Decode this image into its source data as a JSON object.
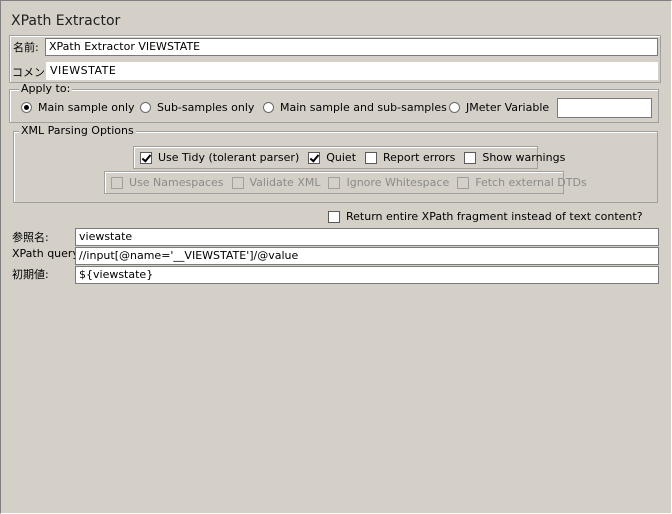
{
  "panel": {
    "title": "XPath Extractor"
  },
  "name_row": {
    "label": "名前:",
    "value": "XPath Extractor VIEWSTATE"
  },
  "comment_row": {
    "label": "コメント",
    "value": "VIEWSTATE"
  },
  "apply_to": {
    "legend": "Apply to:",
    "options": [
      {
        "label": "Main sample only",
        "selected": true
      },
      {
        "label": "Sub-samples only",
        "selected": false
      },
      {
        "label": "Main sample and sub-samples",
        "selected": false
      },
      {
        "label": "JMeter Variable",
        "selected": false
      }
    ],
    "variable_value": ""
  },
  "xml_parsing": {
    "legend": "XML Parsing Options",
    "tidy_options": [
      {
        "label": "Use Tidy (tolerant parser)",
        "checked": true
      },
      {
        "label": "Quiet",
        "checked": true
      },
      {
        "label": "Report errors",
        "checked": false
      },
      {
        "label": "Show warnings",
        "checked": false
      }
    ],
    "namespace_options": [
      {
        "label": "Use Namespaces",
        "checked": false
      },
      {
        "label": "Validate XML",
        "checked": false
      },
      {
        "label": "Ignore Whitespace",
        "checked": false
      },
      {
        "label": "Fetch external DTDs",
        "checked": false
      }
    ]
  },
  "fragment_option": {
    "label": "Return entire XPath fragment instead of text content?",
    "checked": false
  },
  "reference_name": {
    "label": "参照名:",
    "value": "viewstate"
  },
  "xpath_query": {
    "label": "XPath query:",
    "value": "//input[@name='__VIEWSTATE']/@value"
  },
  "default_value": {
    "label": "初期値:",
    "value": "${viewstate}"
  },
  "colors": {
    "background": "#d4d0c8",
    "field": "#ffffff",
    "disabled_text": "#8a8a8a"
  }
}
